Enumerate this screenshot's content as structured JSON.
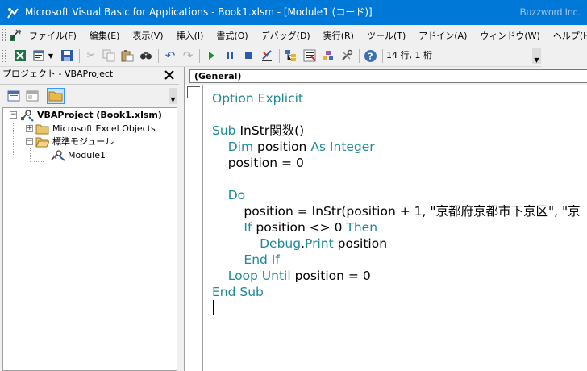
{
  "window": {
    "title": "Microsoft Visual Basic for Applications - Book1.xlsm - [Module1 (コード)]",
    "watermark": "Buzzword Inc.",
    "titlebar_color": "#0078d7"
  },
  "menu": {
    "icon": "vba-excel-icon",
    "items": [
      "ファイル(F)",
      "編集(E)",
      "表示(V)",
      "挿入(I)",
      "書式(O)",
      "デバッグ(D)",
      "実行(R)",
      "ツール(T)",
      "アドイン(A)",
      "ウィンドウ(W)",
      "ヘルプ(H)"
    ]
  },
  "toolbar": {
    "cursor_position": "14 行, 1 桁",
    "buttons": [
      "excel-view-icon",
      "insert-module-icon",
      "save-icon",
      "cut-icon",
      "copy-icon",
      "paste-icon",
      "find-icon",
      "undo-icon",
      "redo-icon",
      "run-icon",
      "break-icon",
      "reset-icon",
      "design-mode-icon",
      "project-explorer-icon",
      "properties-icon",
      "object-browser-icon",
      "toolbox-icon",
      "help-icon"
    ]
  },
  "project_panel": {
    "title": "プロジェクト - VBAProject",
    "close_label": "✕",
    "tree": {
      "root": "VBAProject (Book1.xlsm)",
      "excel_objects": "Microsoft Excel Objects",
      "modules_folder": "標準モジュール",
      "module": "Module1"
    }
  },
  "code_window": {
    "object_combo": "(General)",
    "lines": [
      [
        {
          "t": "Option Explicit",
          "k": true
        }
      ],
      [],
      [
        {
          "t": "Sub ",
          "k": true
        },
        {
          "t": "InStr関数()",
          "k": false
        }
      ],
      [
        {
          "t": "    Dim ",
          "k": true
        },
        {
          "t": "position ",
          "k": false
        },
        {
          "t": "As Integer",
          "k": true
        }
      ],
      [
        {
          "t": "    position = 0",
          "k": false
        }
      ],
      [],
      [
        {
          "t": "    Do",
          "k": true
        }
      ],
      [
        {
          "t": "        position = InStr(position + 1, \"京都府京都市下京区\", \"京",
          "k": false
        }
      ],
      [
        {
          "t": "        If ",
          "k": true
        },
        {
          "t": "position <> 0 ",
          "k": false
        },
        {
          "t": "Then",
          "k": true
        }
      ],
      [
        {
          "t": "            Debug",
          "k": true
        },
        {
          "t": ".",
          "k": false
        },
        {
          "t": "Print",
          "k": true
        },
        {
          "t": " position",
          "k": false
        }
      ],
      [
        {
          "t": "        End If",
          "k": true
        }
      ],
      [
        {
          "t": "    Loop Until ",
          "k": true
        },
        {
          "t": "position = 0",
          "k": false
        }
      ],
      [
        {
          "t": "End Sub",
          "k": true
        }
      ],
      []
    ],
    "keyword_color": "#1e8a96"
  }
}
